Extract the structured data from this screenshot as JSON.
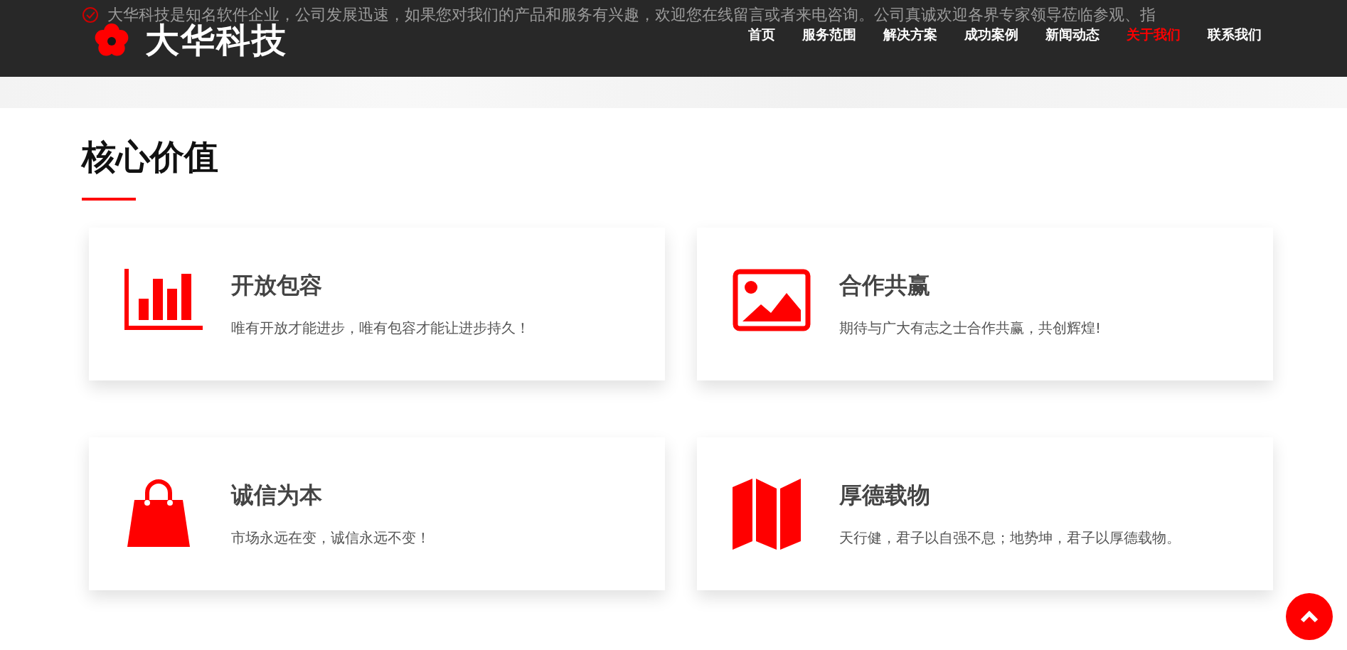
{
  "intro": "大华科技是知名软件企业，公司发展迅速，如果您对我们的产品和服务有兴趣，欢迎您在线留言或者来电咨询。公司真诚欢迎各界专家领导莅临参观、指",
  "header": {
    "logo": "大华科技",
    "nav": [
      {
        "label": "首页",
        "selected": false
      },
      {
        "label": "服务范围",
        "selected": false
      },
      {
        "label": "解决方案",
        "selected": false
      },
      {
        "label": "成功案例",
        "selected": false
      },
      {
        "label": "新闻动态",
        "selected": false
      },
      {
        "label": "关于我们",
        "selected": true
      },
      {
        "label": "联系我们",
        "selected": false
      }
    ]
  },
  "section": {
    "title": "核心价值",
    "cards": [
      {
        "kind": "chart",
        "title": "开放包容",
        "text": "唯有开放才能进步，唯有包容才能让进步持久！"
      },
      {
        "kind": "image",
        "title": "合作共赢",
        "text": "期待与广大有志之士合作共赢，共创辉煌!"
      },
      {
        "kind": "bag",
        "title": "诚信为本",
        "text": "市场永远在变，诚信永远不变！"
      },
      {
        "kind": "map",
        "title": "厚德载物",
        "text": "天行健，君子以自强不息；地势坤，君子以厚德载物。"
      }
    ]
  }
}
